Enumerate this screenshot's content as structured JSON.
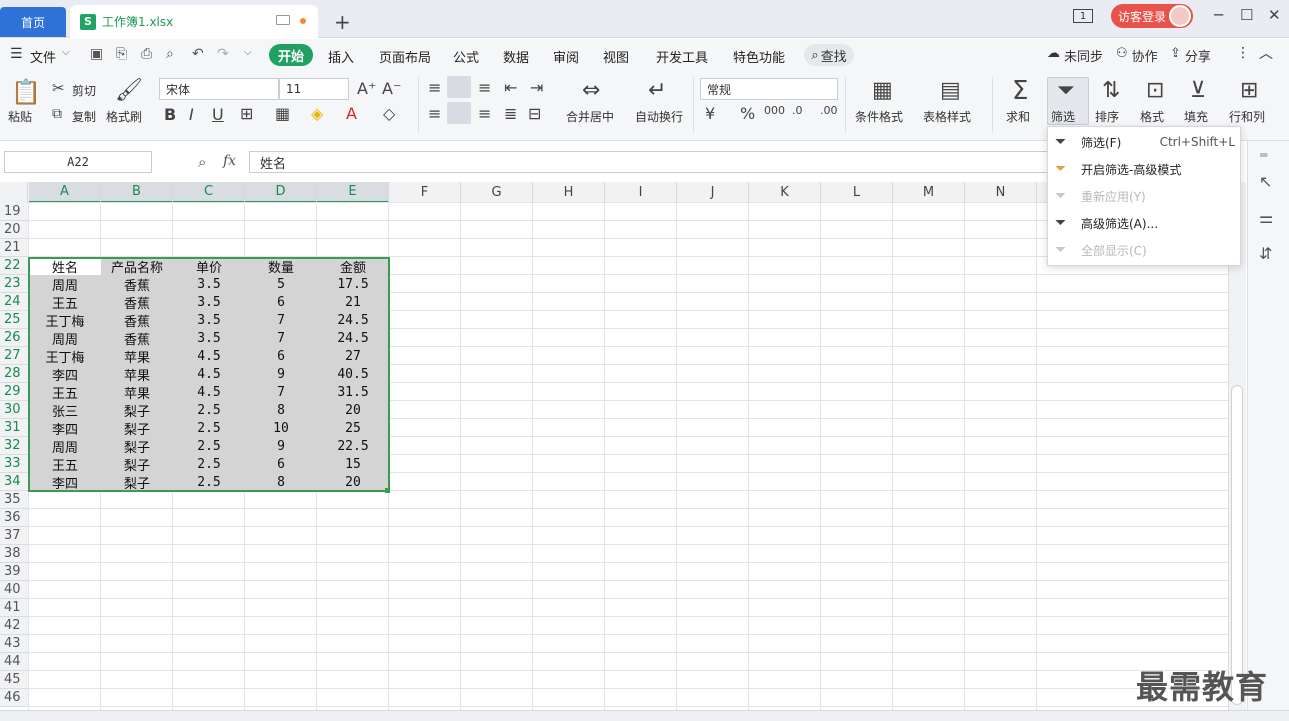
{
  "tabs": {
    "home": "首页",
    "file_name": "工作簿1.xlsx",
    "new_tab": "+"
  },
  "titlebar": {
    "window_num": "1",
    "guest_login": "访客登录"
  },
  "menu": {
    "file": "文件",
    "items": [
      "开始",
      "插入",
      "页面布局",
      "公式",
      "数据",
      "审阅",
      "视图",
      "开发工具",
      "特色功能"
    ],
    "search": "查找",
    "sync": "未同步",
    "collab": "协作",
    "share": "分享"
  },
  "ribbon": {
    "paste": "粘贴",
    "cut": "剪切",
    "copy": "复制",
    "format_painter": "格式刷",
    "font_name": "宋体",
    "font_size": "11",
    "merge_center": "合并居中",
    "wrap_text": "自动换行",
    "number_format": "常规",
    "conditional_format": "条件格式",
    "table_style": "表格样式",
    "sum": "求和",
    "filter": "筛选",
    "sort": "排序",
    "format": "格式",
    "fill": "填充",
    "row_col": "行和列"
  },
  "formula_bar": {
    "name_box": "A22",
    "fx": "fx",
    "content": "姓名"
  },
  "columns": [
    "A",
    "B",
    "C",
    "D",
    "E",
    "F",
    "G",
    "H",
    "I",
    "J",
    "K",
    "L",
    "M",
    "N"
  ],
  "row_numbers": [
    "19",
    "20",
    "21",
    "22",
    "23",
    "24",
    "25",
    "26",
    "27",
    "28",
    "29",
    "30",
    "31",
    "32",
    "33",
    "34",
    "35",
    "36",
    "37",
    "38",
    "39",
    "40",
    "41",
    "42",
    "43",
    "44",
    "45",
    "46"
  ],
  "table": {
    "headers": [
      "姓名",
      "产品名称",
      "单价",
      "数量",
      "金额"
    ],
    "rows": [
      [
        "周周",
        "香蕉",
        "3.5",
        "5",
        "17.5"
      ],
      [
        "王五",
        "香蕉",
        "3.5",
        "6",
        "21"
      ],
      [
        "王丁梅",
        "香蕉",
        "3.5",
        "7",
        "24.5"
      ],
      [
        "周周",
        "香蕉",
        "3.5",
        "7",
        "24.5"
      ],
      [
        "王丁梅",
        "苹果",
        "4.5",
        "6",
        "27"
      ],
      [
        "李四",
        "苹果",
        "4.5",
        "9",
        "40.5"
      ],
      [
        "王五",
        "苹果",
        "4.5",
        "7",
        "31.5"
      ],
      [
        "张三",
        "梨子",
        "2.5",
        "8",
        "20"
      ],
      [
        "李四",
        "梨子",
        "2.5",
        "10",
        "25"
      ],
      [
        "周周",
        "梨子",
        "2.5",
        "9",
        "22.5"
      ],
      [
        "王五",
        "梨子",
        "2.5",
        "6",
        "15"
      ],
      [
        "李四",
        "梨子",
        "2.5",
        "8",
        "20"
      ]
    ]
  },
  "filter_menu": [
    {
      "label": "筛选(F)",
      "shortcut": "Ctrl+Shift+L"
    },
    {
      "label": "开启筛选-高级模式",
      "shortcut": ""
    },
    {
      "label": "重新应用(Y)",
      "shortcut": ""
    },
    {
      "label": "高级筛选(A)...",
      "shortcut": ""
    },
    {
      "label": "全部显示(C)",
      "shortcut": ""
    }
  ],
  "watermark": "最需教育",
  "colors": {
    "accent_green": "#20a162",
    "home_blue": "#2f73d9",
    "guest_red": "#e8524a",
    "selection_border": "#3d9a52"
  }
}
